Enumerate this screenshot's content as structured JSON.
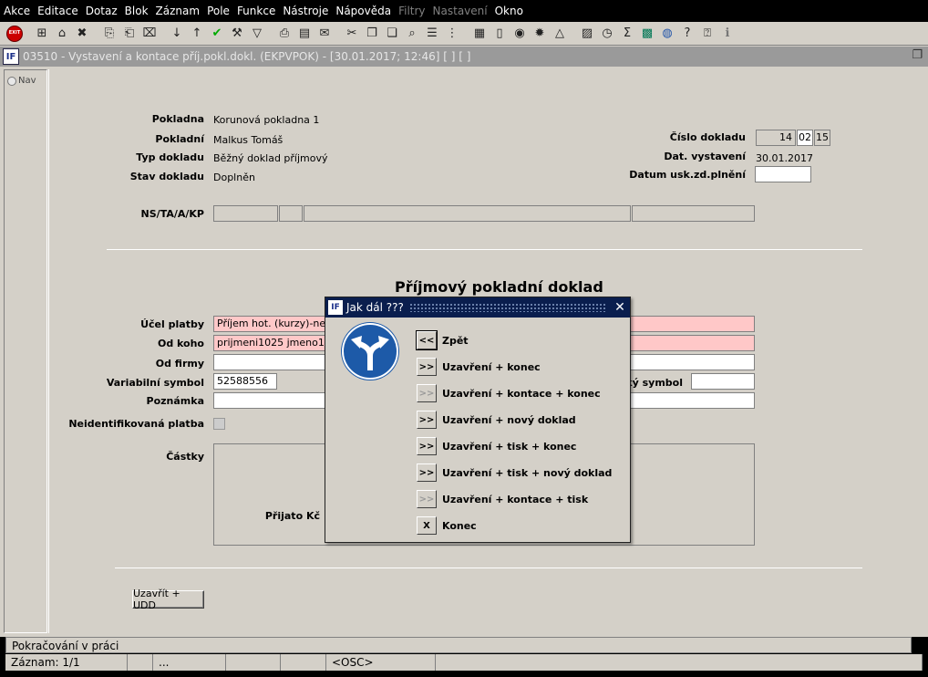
{
  "menu": [
    {
      "label": "Akce",
      "disabled": false
    },
    {
      "label": "Editace",
      "disabled": false
    },
    {
      "label": "Dotaz",
      "disabled": false
    },
    {
      "label": "Blok",
      "disabled": false
    },
    {
      "label": "Záznam",
      "disabled": false
    },
    {
      "label": "Pole",
      "disabled": false
    },
    {
      "label": "Funkce",
      "disabled": false
    },
    {
      "label": "Nástroje",
      "disabled": false
    },
    {
      "label": "Nápověda",
      "disabled": false
    },
    {
      "label": "Filtry",
      "disabled": true
    },
    {
      "label": "Nastavení",
      "disabled": true
    },
    {
      "label": "Okno",
      "disabled": false
    }
  ],
  "window": {
    "title": "03510 - Vystavení a kontace příj.pokl.dokl. (EKPVPOK) - [30.01.2017; 12:46]  [ ]  [ ]",
    "logo": "IF"
  },
  "nav": {
    "label": "Nav"
  },
  "form": {
    "pokladna_label": "Pokladna",
    "pokladna_value": "Korunová pokladna 1",
    "pokladni_label": "Pokladní",
    "pokladni_value": "Malkus Tomáš",
    "typ_label": "Typ dokladu",
    "typ_value": "Běžný doklad příjmový",
    "stav_label": "Stav dokladu",
    "stav_value": "Doplněn",
    "cislo_label": "Číslo dokladu",
    "cislo_1": "14",
    "cislo_2": "02",
    "cislo_3": "15",
    "dat_vyst_label": "Dat. vystavení",
    "dat_vyst_value": "30.01.2017",
    "datum_usk_label": "Datum usk.zd.plnění",
    "nstaakp_label": "NS/TA/A/KP",
    "section_title": "Příjmový pokladní doklad",
    "ucel_label": "Účel platby",
    "ucel_value": "Příjem hot. (kurzy)-není d",
    "odkoho_label": "Od koho",
    "odkoho_value": "prijmeni1025 jmeno1025",
    "odfirmy_label": "Od firmy",
    "var_label": "Variabilní symbol",
    "var_value": "52588556",
    "spec_label": "ký symbol",
    "pozn_label": "Poznámka",
    "neid_label": "Neidentifikovaná platba",
    "castky_label": "Částky",
    "prijato_label": "Přijato Kč",
    "uzavrit_btn": "Uzavřít + UDD"
  },
  "dialog": {
    "title": "Jak dál ???",
    "options": [
      {
        "btn": "<<",
        "label": "Zpět",
        "dim": false
      },
      {
        "btn": ">>",
        "label": "Uzavření + konec",
        "dim": false
      },
      {
        "btn": ">>",
        "label": "Uzavření + kontace + konec",
        "dim": true
      },
      {
        "btn": ">>",
        "label": "Uzavření + nový doklad",
        "dim": false
      },
      {
        "btn": ">>",
        "label": "Uzavření + tisk + konec",
        "dim": false
      },
      {
        "btn": ">>",
        "label": "Uzavření + tisk + nový doklad",
        "dim": false
      },
      {
        "btn": ">>",
        "label": "Uzavření + kontace + tisk",
        "dim": true
      },
      {
        "btn": "X",
        "label": "Konec",
        "dim": false
      }
    ]
  },
  "status": {
    "line1": "Pokračování v práci",
    "record": "Záznam: 1/1",
    "ellipsis": "...",
    "osc": "<OSC>"
  }
}
